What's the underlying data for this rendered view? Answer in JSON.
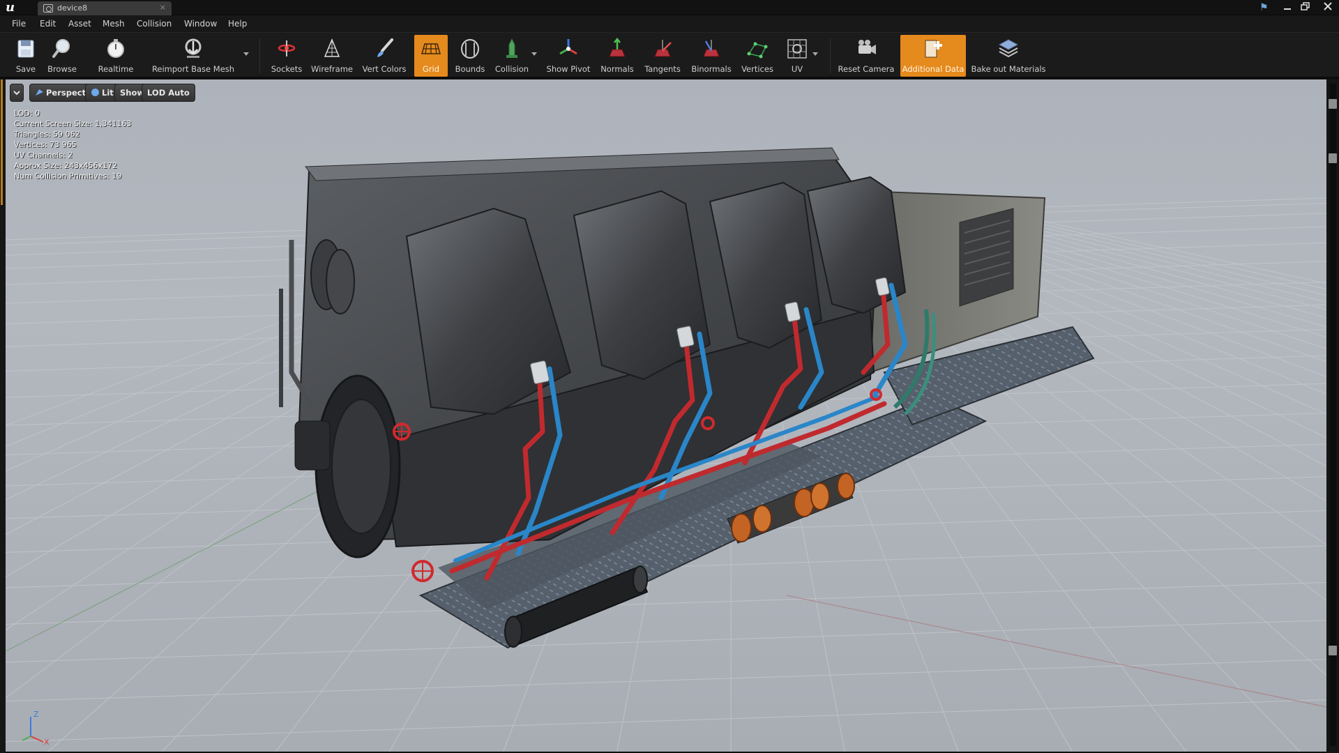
{
  "titlebar": {
    "tab_label": "device8",
    "tab_close": "×",
    "min_glyph": "🗕",
    "max_glyph": "🗗",
    "close_glyph": "✕"
  },
  "menu": [
    "File",
    "Edit",
    "Asset",
    "Mesh",
    "Collision",
    "Window",
    "Help"
  ],
  "toolbar": {
    "save": "Save",
    "browse": "Browse",
    "realtime": "Realtime",
    "reimport": "Reimport Base Mesh",
    "sockets": "Sockets",
    "wireframe": "Wireframe",
    "vert_colors": "Vert Colors",
    "grid": "Grid",
    "bounds": "Bounds",
    "collision": "Collision",
    "show_pivot": "Show Pivot",
    "normals": "Normals",
    "tangents": "Tangents",
    "binormals": "Binormals",
    "vertices": "Vertices",
    "uv": "UV",
    "reset_camera": "Reset Camera",
    "additional_data": "Additional Data",
    "bake_out_materials": "Bake out Materials",
    "active_color": "#e58a1d"
  },
  "viewport": {
    "perspective": "Perspective",
    "lit": "Lit",
    "show": "Show",
    "lod": "LOD Auto",
    "stats": [
      "LOD:  0",
      "Current Screen Size:  1,341163",
      "Triangles:  59 062",
      "Vertices:  73 965",
      "UV Channels:  2",
      "Approx Size: 243x456x172",
      "Num Collision Primitives:  19"
    ],
    "gizmo": {
      "z": "Z",
      "x": "X"
    }
  }
}
